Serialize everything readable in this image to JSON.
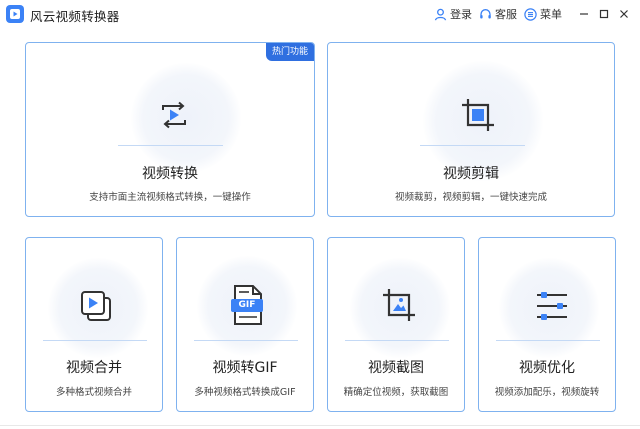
{
  "app": {
    "title": "风云视频转换器",
    "icon": "app-logo-icon"
  },
  "titlebar": {
    "login_label": "登录",
    "service_label": "客服",
    "menu_label": "菜单"
  },
  "colors": {
    "accent": "#2f6fe0",
    "card_border": "#7fb2ef",
    "icon_blue": "#3b82f6"
  },
  "cards": {
    "convert": {
      "title": "视频转换",
      "desc": "支持市面主流视频格式转换，一键操作",
      "badge": "热门功能",
      "icon": "video-convert-icon"
    },
    "clip": {
      "title": "视频剪辑",
      "desc": "视频裁剪，视频剪辑，一键快速完成",
      "icon": "crop-icon"
    },
    "merge": {
      "title": "视频合并",
      "desc": "多种格式视频合并",
      "icon": "video-merge-icon"
    },
    "gif": {
      "title": "视频转GIF",
      "desc": "多种视频格式转换成GIF",
      "icon": "gif-file-icon",
      "icon_text": "GIF"
    },
    "capture": {
      "title": "视频截图",
      "desc": "精确定位视频，获取截图",
      "icon": "crop-image-icon"
    },
    "optimize": {
      "title": "视频优化",
      "desc": "视频添加配乐，视频旋转",
      "icon": "sliders-icon"
    }
  }
}
